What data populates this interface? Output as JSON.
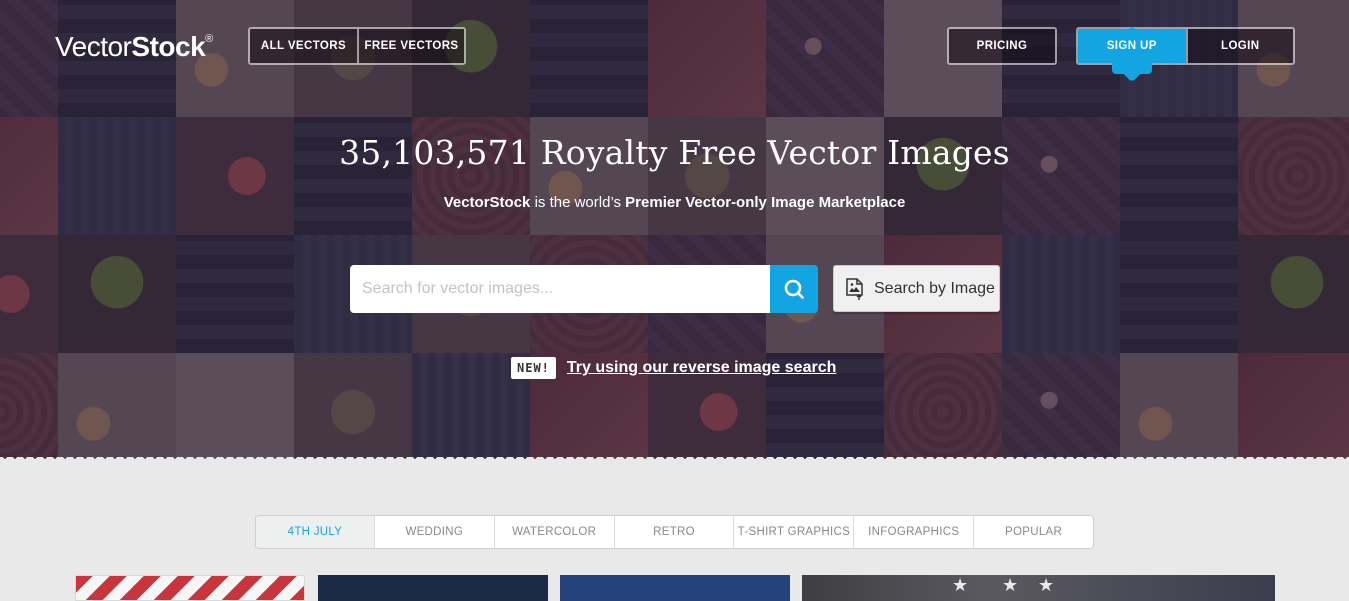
{
  "brand": {
    "logo_light": "Vector",
    "logo_bold": "Stock",
    "logo_reg": "®"
  },
  "nav": {
    "all_vectors": "ALL VECTORS",
    "free_vectors": "FREE VECTORS",
    "pricing": "PRICING",
    "sign_up": "SIGN UP",
    "login": "LOGIN"
  },
  "hero": {
    "headline": "35,103,571 Royalty Free Vector Images",
    "tagline_brand": "VectorStock",
    "tagline_mid": " is the world’s ",
    "tagline_strong": "Premier Vector-only Image Marketplace"
  },
  "search": {
    "placeholder": "Search for vector images...",
    "value": "",
    "by_image_label": "Search by Image"
  },
  "promo": {
    "badge": "NEW!",
    "link": "Try using our reverse image search"
  },
  "categories": [
    {
      "label": "4TH JULY",
      "active": true
    },
    {
      "label": "WEDDING",
      "active": false
    },
    {
      "label": "WATERCOLOR",
      "active": false
    },
    {
      "label": "RETRO",
      "active": false
    },
    {
      "label": "T-SHIRT GRAPHICS",
      "active": false
    },
    {
      "label": "INFOGRAPHICS",
      "active": false
    },
    {
      "label": "POPULAR",
      "active": false
    }
  ],
  "colors": {
    "accent": "#13a5e1",
    "page_bg": "#e8e9e8"
  }
}
